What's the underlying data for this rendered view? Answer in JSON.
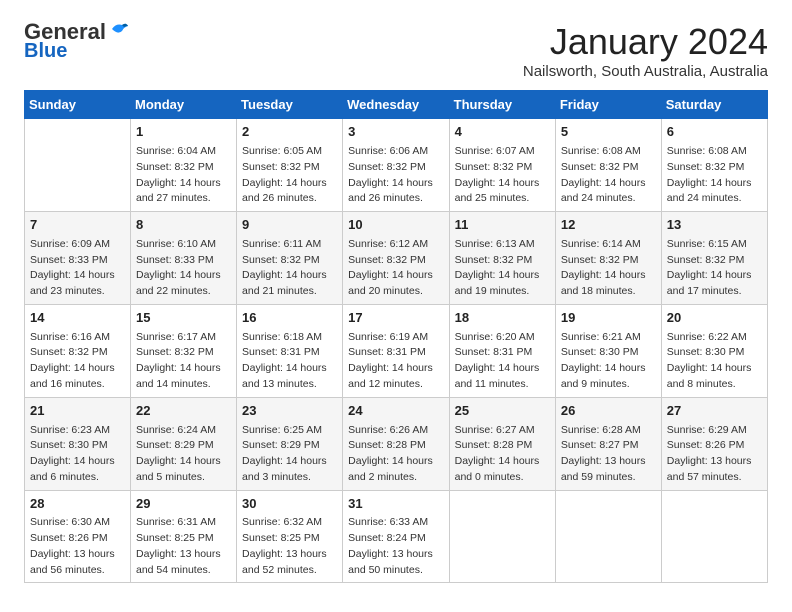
{
  "header": {
    "logo_general": "General",
    "logo_blue": "Blue",
    "title": "January 2024",
    "subtitle": "Nailsworth, South Australia, Australia"
  },
  "days_of_week": [
    "Sunday",
    "Monday",
    "Tuesday",
    "Wednesday",
    "Thursday",
    "Friday",
    "Saturday"
  ],
  "weeks": [
    [
      {
        "day": "",
        "info": ""
      },
      {
        "day": "1",
        "info": "Sunrise: 6:04 AM\nSunset: 8:32 PM\nDaylight: 14 hours\nand 27 minutes."
      },
      {
        "day": "2",
        "info": "Sunrise: 6:05 AM\nSunset: 8:32 PM\nDaylight: 14 hours\nand 26 minutes."
      },
      {
        "day": "3",
        "info": "Sunrise: 6:06 AM\nSunset: 8:32 PM\nDaylight: 14 hours\nand 26 minutes."
      },
      {
        "day": "4",
        "info": "Sunrise: 6:07 AM\nSunset: 8:32 PM\nDaylight: 14 hours\nand 25 minutes."
      },
      {
        "day": "5",
        "info": "Sunrise: 6:08 AM\nSunset: 8:32 PM\nDaylight: 14 hours\nand 24 minutes."
      },
      {
        "day": "6",
        "info": "Sunrise: 6:08 AM\nSunset: 8:32 PM\nDaylight: 14 hours\nand 24 minutes."
      }
    ],
    [
      {
        "day": "7",
        "info": "Sunrise: 6:09 AM\nSunset: 8:33 PM\nDaylight: 14 hours\nand 23 minutes."
      },
      {
        "day": "8",
        "info": "Sunrise: 6:10 AM\nSunset: 8:33 PM\nDaylight: 14 hours\nand 22 minutes."
      },
      {
        "day": "9",
        "info": "Sunrise: 6:11 AM\nSunset: 8:32 PM\nDaylight: 14 hours\nand 21 minutes."
      },
      {
        "day": "10",
        "info": "Sunrise: 6:12 AM\nSunset: 8:32 PM\nDaylight: 14 hours\nand 20 minutes."
      },
      {
        "day": "11",
        "info": "Sunrise: 6:13 AM\nSunset: 8:32 PM\nDaylight: 14 hours\nand 19 minutes."
      },
      {
        "day": "12",
        "info": "Sunrise: 6:14 AM\nSunset: 8:32 PM\nDaylight: 14 hours\nand 18 minutes."
      },
      {
        "day": "13",
        "info": "Sunrise: 6:15 AM\nSunset: 8:32 PM\nDaylight: 14 hours\nand 17 minutes."
      }
    ],
    [
      {
        "day": "14",
        "info": "Sunrise: 6:16 AM\nSunset: 8:32 PM\nDaylight: 14 hours\nand 16 minutes."
      },
      {
        "day": "15",
        "info": "Sunrise: 6:17 AM\nSunset: 8:32 PM\nDaylight: 14 hours\nand 14 minutes."
      },
      {
        "day": "16",
        "info": "Sunrise: 6:18 AM\nSunset: 8:31 PM\nDaylight: 14 hours\nand 13 minutes."
      },
      {
        "day": "17",
        "info": "Sunrise: 6:19 AM\nSunset: 8:31 PM\nDaylight: 14 hours\nand 12 minutes."
      },
      {
        "day": "18",
        "info": "Sunrise: 6:20 AM\nSunset: 8:31 PM\nDaylight: 14 hours\nand 11 minutes."
      },
      {
        "day": "19",
        "info": "Sunrise: 6:21 AM\nSunset: 8:30 PM\nDaylight: 14 hours\nand 9 minutes."
      },
      {
        "day": "20",
        "info": "Sunrise: 6:22 AM\nSunset: 8:30 PM\nDaylight: 14 hours\nand 8 minutes."
      }
    ],
    [
      {
        "day": "21",
        "info": "Sunrise: 6:23 AM\nSunset: 8:30 PM\nDaylight: 14 hours\nand 6 minutes."
      },
      {
        "day": "22",
        "info": "Sunrise: 6:24 AM\nSunset: 8:29 PM\nDaylight: 14 hours\nand 5 minutes."
      },
      {
        "day": "23",
        "info": "Sunrise: 6:25 AM\nSunset: 8:29 PM\nDaylight: 14 hours\nand 3 minutes."
      },
      {
        "day": "24",
        "info": "Sunrise: 6:26 AM\nSunset: 8:28 PM\nDaylight: 14 hours\nand 2 minutes."
      },
      {
        "day": "25",
        "info": "Sunrise: 6:27 AM\nSunset: 8:28 PM\nDaylight: 14 hours\nand 0 minutes."
      },
      {
        "day": "26",
        "info": "Sunrise: 6:28 AM\nSunset: 8:27 PM\nDaylight: 13 hours\nand 59 minutes."
      },
      {
        "day": "27",
        "info": "Sunrise: 6:29 AM\nSunset: 8:26 PM\nDaylight: 13 hours\nand 57 minutes."
      }
    ],
    [
      {
        "day": "28",
        "info": "Sunrise: 6:30 AM\nSunset: 8:26 PM\nDaylight: 13 hours\nand 56 minutes."
      },
      {
        "day": "29",
        "info": "Sunrise: 6:31 AM\nSunset: 8:25 PM\nDaylight: 13 hours\nand 54 minutes."
      },
      {
        "day": "30",
        "info": "Sunrise: 6:32 AM\nSunset: 8:25 PM\nDaylight: 13 hours\nand 52 minutes."
      },
      {
        "day": "31",
        "info": "Sunrise: 6:33 AM\nSunset: 8:24 PM\nDaylight: 13 hours\nand 50 minutes."
      },
      {
        "day": "",
        "info": ""
      },
      {
        "day": "",
        "info": ""
      },
      {
        "day": "",
        "info": ""
      }
    ]
  ]
}
